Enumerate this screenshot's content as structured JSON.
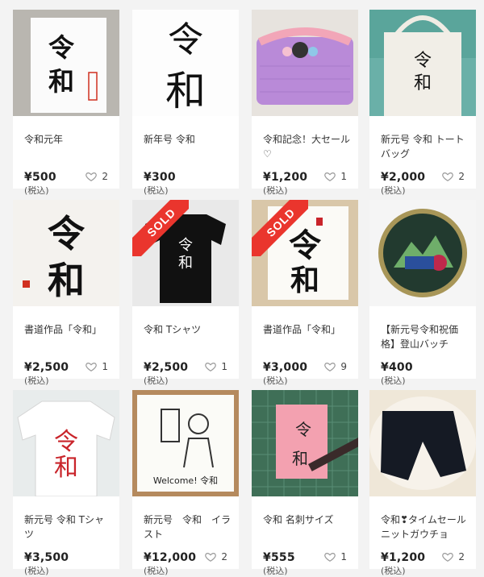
{
  "items": [
    {
      "title": "令和元年",
      "price": "¥500",
      "tax": "(税込)",
      "likes": "2",
      "sold": false
    },
    {
      "title": "新年号 令和",
      "price": "¥300",
      "tax": "(税込)",
      "likes": "",
      "sold": false
    },
    {
      "title": "令和記念！大セール♡",
      "price": "¥1,200",
      "tax": "(税込)",
      "likes": "1",
      "sold": false
    },
    {
      "title": "新元号 令和 トートバッグ",
      "price": "¥2,000",
      "tax": "(税込)",
      "likes": "2",
      "sold": false
    },
    {
      "title": "書道作品「令和」",
      "price": "¥2,500",
      "tax": "(税込)",
      "likes": "1",
      "sold": false
    },
    {
      "title": "令和 Tシャツ",
      "price": "¥2,500",
      "tax": "(税込)",
      "likes": "1",
      "sold": true,
      "sold_label": "SOLD"
    },
    {
      "title": "書道作品「令和」",
      "price": "¥3,000",
      "tax": "(税込)",
      "likes": "9",
      "sold": true,
      "sold_label": "SOLD"
    },
    {
      "title": "【新元号令和祝価格】登山バッチ",
      "price": "¥400",
      "tax": "(税込)",
      "likes": "",
      "sold": false
    },
    {
      "title": "新元号 令和 Tシャツ",
      "price": "¥3,500",
      "tax": "(税込)",
      "likes": "",
      "sold": false
    },
    {
      "title": "新元号　令和　イラスト",
      "price": "¥12,000",
      "tax": "(税込)",
      "likes": "2",
      "sold": false
    },
    {
      "title": "令和 名刺サイズ",
      "price": "¥555",
      "tax": "(税込)",
      "likes": "1",
      "sold": false
    },
    {
      "title": "令和❣タイムセール ニットガウチョ",
      "price": "¥1,200",
      "tax": "(税込)",
      "likes": "2",
      "sold": false
    }
  ],
  "thumb_text": {
    "reiwa": "令和",
    "rei": "令",
    "wa": "和",
    "welcome": "Welcome! 令和"
  }
}
